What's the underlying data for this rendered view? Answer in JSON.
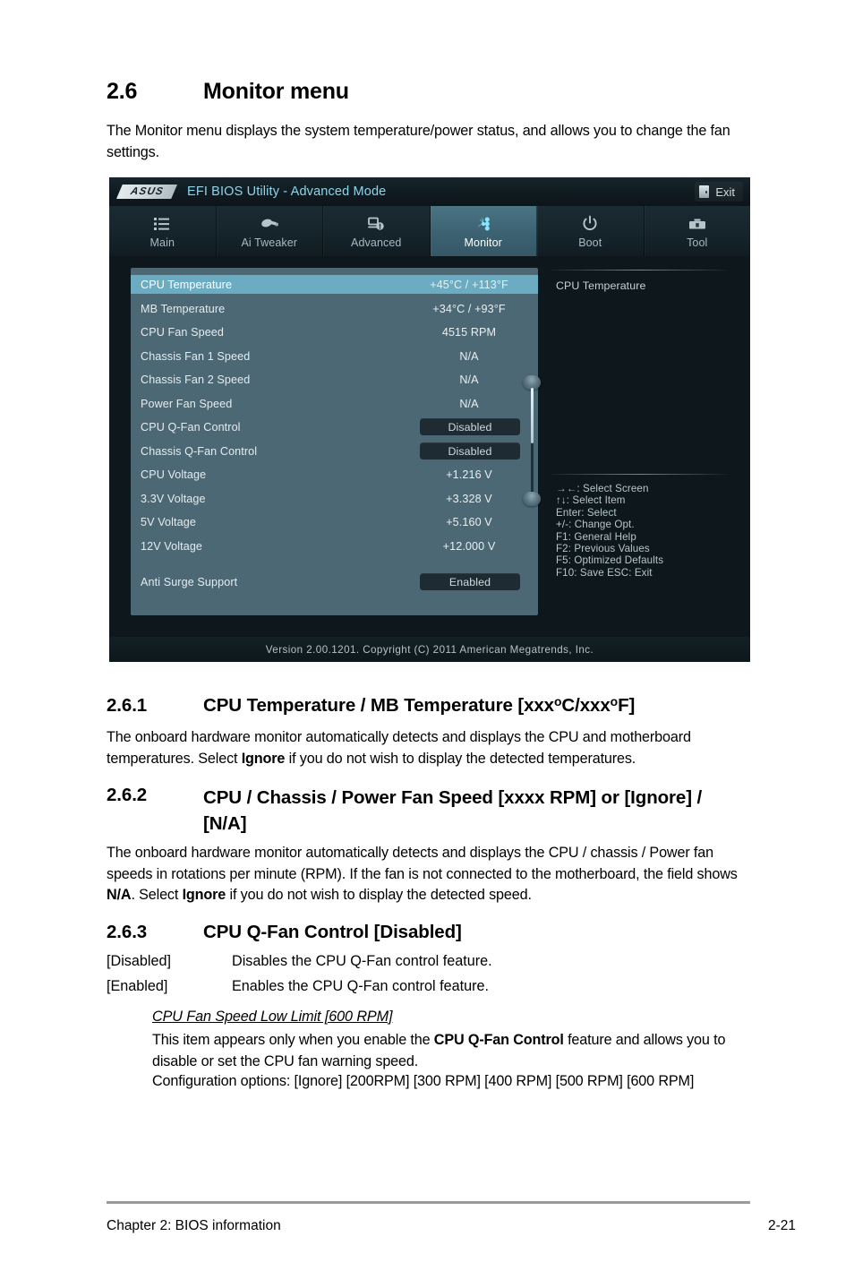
{
  "document": {
    "section": {
      "number": "2.6",
      "title": "Monitor menu"
    },
    "intro": "The Monitor menu displays the system temperature/power status, and allows you to change the fan settings.",
    "sub_261": {
      "number": "2.6.1",
      "title_pre": "CPU Temperature / MB Temperature [xxx",
      "title_mid": "C/xxx",
      "title_end": "F]",
      "body_1": "The onboard hardware monitor automatically detects and displays the CPU and motherboard temperatures. Select ",
      "body_bold": "Ignore",
      "body_2": " if you do not wish to display the detected temperatures."
    },
    "sub_262": {
      "number": "2.6.2",
      "title": "CPU / Chassis / Power Fan Speed [xxxx RPM] or [Ignore] / [N/A]",
      "body_1": "The onboard hardware monitor automatically detects and displays the CPU / chassis / Power fan speeds in rotations per minute (RPM). If the fan is not connected to the motherboard, the field shows ",
      "body_bold_1": "N/A",
      "body_2": ". Select ",
      "body_bold_2": "Ignore",
      "body_3": " if you do not wish to display the detected speed."
    },
    "sub_263": {
      "number": "2.6.3",
      "title": "CPU Q-Fan Control [Disabled]",
      "options": [
        {
          "key": "[Disabled]",
          "desc": "Disables the CPU Q-Fan control feature."
        },
        {
          "key": "[Enabled]",
          "desc": "Enables the CPU Q-Fan control feature."
        }
      ],
      "note_heading": "CPU Fan Speed Low Limit [600 RPM]",
      "note_body_1": "This item appears only when you enable the ",
      "note_body_bold": "CPU Q-Fan Control",
      "note_body_2": " feature and allows you to disable or set the CPU fan warning speed.",
      "note_config": "Configuration options: [Ignore] [200RPM] [300 RPM] [400 RPM] [500 RPM] [600 RPM]"
    },
    "footer": {
      "left": "Chapter 2: BIOS information",
      "right": "2-21"
    }
  },
  "bios": {
    "brand": "ASUS",
    "title": "EFI BIOS Utility - Advanced Mode",
    "exit": {
      "label": "Exit",
      "icon": "exit-door-icon"
    },
    "tabs": [
      {
        "label": "Main",
        "icon": "list-icon",
        "active": false
      },
      {
        "label": "Ai  Tweaker",
        "icon": "tweaker-icon",
        "active": false
      },
      {
        "label": "Advanced",
        "icon": "advanced-icon",
        "active": false
      },
      {
        "label": "Monitor",
        "icon": "monitor-fan-icon",
        "active": true
      },
      {
        "label": "Boot",
        "icon": "power-icon",
        "active": false
      },
      {
        "label": "Tool",
        "icon": "toolbox-icon",
        "active": false
      }
    ],
    "items": [
      {
        "label": "CPU Temperature",
        "value": "+45°C / +113°F",
        "type": "text",
        "selected": true
      },
      {
        "label": "MB Temperature",
        "value": "+34°C / +93°F",
        "type": "text",
        "selected": false
      },
      {
        "label": "CPU Fan Speed",
        "value": "4515 RPM",
        "type": "text",
        "selected": false
      },
      {
        "label": "Chassis Fan 1 Speed",
        "value": "N/A",
        "type": "text",
        "selected": false
      },
      {
        "label": "Chassis Fan 2 Speed",
        "value": "N/A",
        "type": "text",
        "selected": false
      },
      {
        "label": "Power Fan Speed",
        "value": "N/A",
        "type": "text",
        "selected": false
      },
      {
        "label": "CPU Q-Fan Control",
        "value": "Disabled",
        "type": "option",
        "selected": false
      },
      {
        "label": "Chassis Q-Fan Control",
        "value": "Disabled",
        "type": "option",
        "selected": false
      },
      {
        "label": "CPU Voltage",
        "value": "+1.216 V",
        "type": "text",
        "selected": false
      },
      {
        "label": "3.3V Voltage",
        "value": "+3.328 V",
        "type": "text",
        "selected": false
      },
      {
        "label": "5V Voltage",
        "value": "+5.160 V",
        "type": "text",
        "selected": false
      },
      {
        "label": "12V Voltage",
        "value": "+12.000 V",
        "type": "text",
        "selected": false
      },
      {
        "label": "Anti Surge Support",
        "value": "Enabled",
        "type": "option",
        "selected": false
      }
    ],
    "help": {
      "title": "CPU Temperature"
    },
    "keyhelp": [
      "→←:  Select Screen",
      "↑↓:  Select Item",
      "Enter:  Select",
      "+/-:  Change Opt.",
      "F1:  General Help",
      "F2:  Previous Values",
      "F5:  Optimized Defaults",
      "F10:  Save    ESC:  Exit"
    ],
    "version": "Version  2.00.1201.   Copyright  (C)  2011  American  Megatrends,  Inc.",
    "colors": {
      "selection": "#6bacc3",
      "panel": "#4d6875",
      "chrome": "#0d171c",
      "accent": "#8fd4ea"
    }
  }
}
